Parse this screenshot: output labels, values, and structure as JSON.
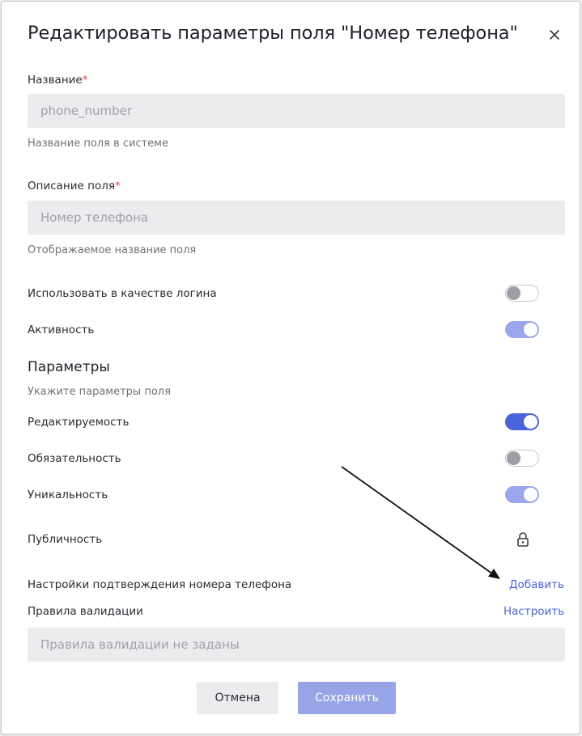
{
  "dialog": {
    "title": "Редактировать параметры поля \"Номер телефона\""
  },
  "fields": {
    "name": {
      "label": "Название",
      "required_mark": "*",
      "value": "phone_number",
      "hint": "Название поля в системе"
    },
    "description": {
      "label": "Описание поля",
      "required_mark": "*",
      "value": "Номер телефона",
      "hint": "Отображаемое название поля"
    }
  },
  "toggles": {
    "use_as_login": {
      "label": "Использовать в качестве логина",
      "state": "off"
    },
    "activity": {
      "label": "Активность",
      "state": "on-disabled"
    }
  },
  "parameters": {
    "title": "Параметры",
    "hint": "Укажите параметры поля",
    "editable": {
      "label": "Редактируемость",
      "state": "on"
    },
    "required": {
      "label": "Обязательность",
      "state": "off"
    },
    "unique": {
      "label": "Уникальность",
      "state": "on-disabled"
    },
    "public": {
      "label": "Публичность",
      "icon": "lock-icon"
    }
  },
  "phone_confirmation": {
    "label": "Настройки подтверждения номера телефона",
    "action": "Добавить"
  },
  "validation": {
    "label": "Правила валидации",
    "action": "Настроить",
    "placeholder": "Правила валидации не заданы"
  },
  "buttons": {
    "cancel": "Отмена",
    "save": "Сохранить"
  },
  "colors": {
    "accent": "#4a63d8",
    "accent_disabled": "#97a4e6",
    "required": "#e5484d",
    "input_bg": "#ececee"
  }
}
